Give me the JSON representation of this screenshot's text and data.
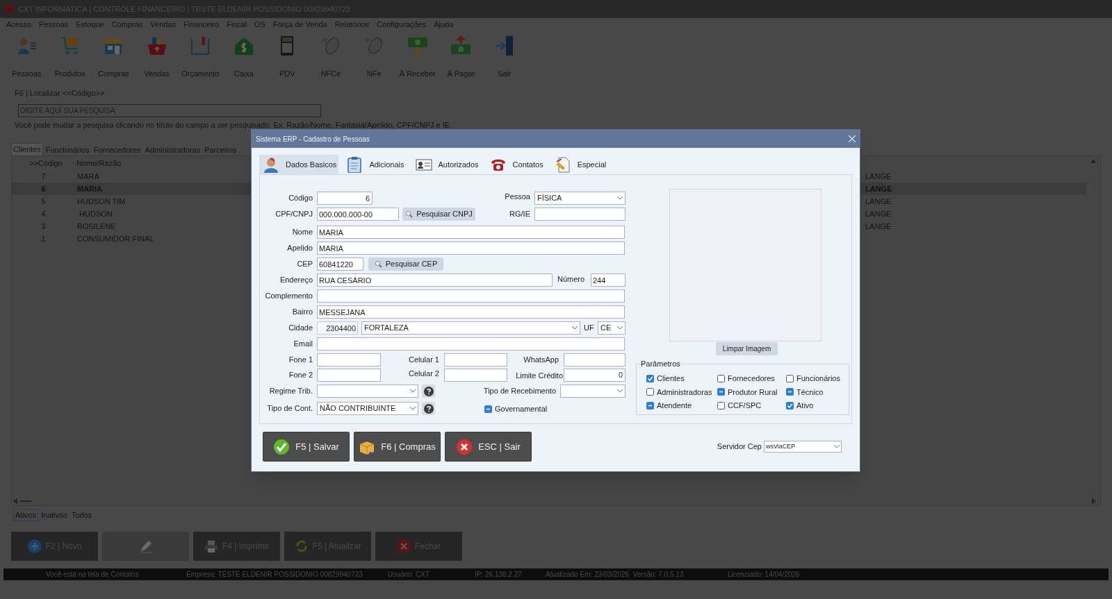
{
  "window": {
    "title": "CXT INFORMATICA | CONTROLE FINANCEIRO | TESTE ELDENIR POSSIDONIO 00829940723"
  },
  "menu": [
    "Acesso",
    "Pessoas",
    "Estoque",
    "Compras",
    "Vendas",
    "Financeiro",
    "Fiscal",
    "OS",
    "Força de Venda",
    "Relatórios",
    "Configurações",
    "Ajuda"
  ],
  "toolbar": [
    {
      "label": "Pessoas"
    },
    {
      "label": "Produtos"
    },
    {
      "label": "Compras"
    },
    {
      "label": "Vendas"
    },
    {
      "label": "Orçamento"
    },
    {
      "label": "Caixa"
    },
    {
      "label": "PDV"
    },
    {
      "label": "NFCe"
    },
    {
      "label": "NFe"
    },
    {
      "label": "À Receber"
    },
    {
      "label": "À Pagar"
    },
    {
      "label": "Sair"
    }
  ],
  "search": {
    "label": "F6 | Localizar <<Código>>",
    "placeholder": "DIGITE AQUI SUA PESQUISA",
    "hint": "Você pode mudar a pesquisa clicando no título do campo a ser pesquisado. Ex: Razão/Nome, Fantasia/Apelido, CPF/CNPJ e IE."
  },
  "tabs": [
    {
      "label": "Clientes",
      "selected": true
    },
    {
      "label": "Funcionários",
      "selected": false
    },
    {
      "label": "Fornecedores",
      "selected": false
    },
    {
      "label": "Administradoras",
      "selected": false
    },
    {
      "label": "Parceiros",
      "selected": false
    }
  ],
  "table": {
    "columns": [
      ">>Código",
      "Nome/Razão"
    ],
    "rows": [
      {
        "cells": [
          "7",
          "MARA",
          "LANGE"
        ],
        "selected": false
      },
      {
        "cells": [
          "6",
          "MARIA",
          "LANGE"
        ],
        "selected": true
      },
      {
        "cells": [
          "5",
          "HUDSON TIM",
          "LANGE"
        ],
        "selected": false
      },
      {
        "cells": [
          "4",
          " HUDSON",
          "LANGE"
        ],
        "selected": false
      },
      {
        "cells": [
          "3",
          "ROSILENE",
          "LANGE"
        ],
        "selected": false
      },
      {
        "cells": [
          "1",
          "CONSUMIDOR FINAL"
        ],
        "selected": false
      }
    ]
  },
  "filters": [
    {
      "label": "Ativos",
      "selected": true
    },
    {
      "label": "Inativos",
      "selected": false
    },
    {
      "label": "Todos",
      "selected": false
    }
  ],
  "actions": [
    {
      "label": "F2 | Novo",
      "disabled": false
    },
    {
      "disabled": true
    },
    {
      "label": "F4 | Imprimir",
      "disabled": false
    },
    {
      "label": "F5 | Atualizar",
      "disabled": false
    },
    {
      "label": "Fechar",
      "disabled": false
    }
  ],
  "status_bar": [
    "Você está na tela de Contatos",
    "Empresa: TESTE ELDENIR POSSIDONIO 00829940723",
    "Usuário: CXT",
    "IP: 26.138.2.27",
    "Atualizado Em: 23/03/2026  Versão: 7.0.5.13",
    "Licenciado: 14/04/2026"
  ],
  "dialog": {
    "title": "Sistema ERP - Cadastro de Pessoas",
    "tabs": [
      {
        "label": "Dados Basicos",
        "selected": true
      },
      {
        "label": "Adicionais",
        "selected": false
      },
      {
        "label": "Autorizados",
        "selected": false
      },
      {
        "label": "Contatos",
        "selected": false
      },
      {
        "label": "Especial",
        "selected": false
      }
    ],
    "form": {
      "codigo": {
        "label": "Código",
        "value": "6"
      },
      "pessoa": {
        "label": "Pessoa",
        "value": "FÍSICA"
      },
      "cpf_cnpj": {
        "label": "CPF/CNPJ",
        "value": "000.000.000-00"
      },
      "pesquisar_cnpj": "Pesquisar CNPJ",
      "rg_ie": {
        "label": "RG/IE"
      },
      "nome": {
        "label": "Nome",
        "value": "MARIA"
      },
      "apelido": {
        "label": "Apelido",
        "value": "MARIA"
      },
      "cep": {
        "label": "CEP",
        "value": "60841220"
      },
      "pesquisar_cep": "Pesquisar CEP",
      "endereco": {
        "label": "Endereço",
        "value": "RUA CESÁRIO"
      },
      "numero": {
        "label": "Número",
        "value": "244"
      },
      "complemento": {
        "label": "Complemento"
      },
      "bairro": {
        "label": "Bairro",
        "value": "MESSEJANA"
      },
      "cidade": {
        "label": "Cidade",
        "code": "2304400",
        "value": "FORTALEZA"
      },
      "uf": {
        "label": "UF",
        "value": "CE"
      },
      "email": {
        "label": "Email"
      },
      "fone_1": {
        "label": "Fone 1"
      },
      "celular_1": {
        "label": "Celular 1"
      },
      "whatsapp": {
        "label": "WhatsApp"
      },
      "fone_2": {
        "label": "Fone 2"
      },
      "celular_2": {
        "label": "Celular 2"
      },
      "limite_credito": {
        "label": "Limite Crédito",
        "value": "0"
      },
      "regime_trib": {
        "label": "Regime Trib."
      },
      "tipo_recebimento": {
        "label": "Tipo de Recebimento"
      },
      "tipo_cont": {
        "label": "Tipo de Cont.",
        "value": "NÃO CONTRIBUINTE"
      },
      "governamental": {
        "label": "Governamental",
        "checked": false,
        "indeterminate": true
      }
    },
    "clear_image": "Limpar Imagem",
    "parameters": {
      "title": "Parâmetros",
      "options": [
        {
          "label": "Clientes",
          "checked": true,
          "indeterminate": false
        },
        {
          "label": "Fornecedores",
          "checked": false,
          "indeterminate": false
        },
        {
          "label": "Funcionários",
          "checked": false,
          "indeterminate": false
        },
        {
          "label": "Administradoras",
          "checked": false,
          "indeterminate": false
        },
        {
          "label": "Produtor Rural",
          "checked": false,
          "indeterminate": true
        },
        {
          "label": "Técnico",
          "checked": false,
          "indeterminate": true
        },
        {
          "label": "Atendente",
          "checked": false,
          "indeterminate": true
        },
        {
          "label": "CCF/SPC",
          "checked": false,
          "indeterminate": false
        },
        {
          "label": "Ativo",
          "checked": true,
          "indeterminate": false
        }
      ]
    },
    "buttons": [
      "F5 | Salvar",
      "F6 | Compras",
      "ESC | Sair"
    ],
    "servidor_cep": {
      "label": "Servidor Cep",
      "value": "wsViaCEP"
    }
  }
}
